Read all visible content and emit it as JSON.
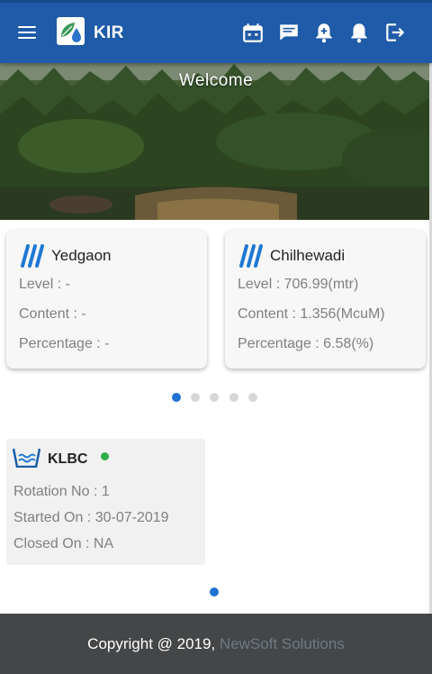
{
  "app": {
    "title": "KIR",
    "accent_color": "#1f5ba8"
  },
  "topbar": {
    "menu_icon": "hamburger-menu-icon",
    "logo_icon": "leaf-drop-logo-icon",
    "actions": [
      {
        "name": "calendar-icon"
      },
      {
        "name": "chat-icon"
      },
      {
        "name": "add-alert-icon"
      },
      {
        "name": "bell-icon"
      },
      {
        "name": "logout-icon"
      }
    ]
  },
  "banner": {
    "welcome": "Welcome"
  },
  "reservoirs": [
    {
      "name": "Yedgaon",
      "icon": "water-level-icon",
      "level": "Level : -",
      "content": "Content : -",
      "percentage": "Percentage : -"
    },
    {
      "name": "Chilhewadi",
      "icon": "water-level-icon",
      "level": "Level : 706.99(mtr)",
      "content": "Content : 1.356(McuM)",
      "percentage": "Percentage : 6.58(%)"
    }
  ],
  "reservoir_carousel": {
    "total_pages": 5,
    "active_page": 1
  },
  "canal": {
    "name": "KLBC",
    "icon": "canal-water-icon",
    "status_color": "#2fae4a",
    "rotation": "Rotation No : 1",
    "started": "Started On : 30-07-2019",
    "closed": "Closed On : NA"
  },
  "canal_carousel": {
    "total_pages": 1,
    "active_page": 1
  },
  "footer": {
    "copyright": "Copyright @ 2019,",
    "company": "NewSoft Solutions"
  }
}
